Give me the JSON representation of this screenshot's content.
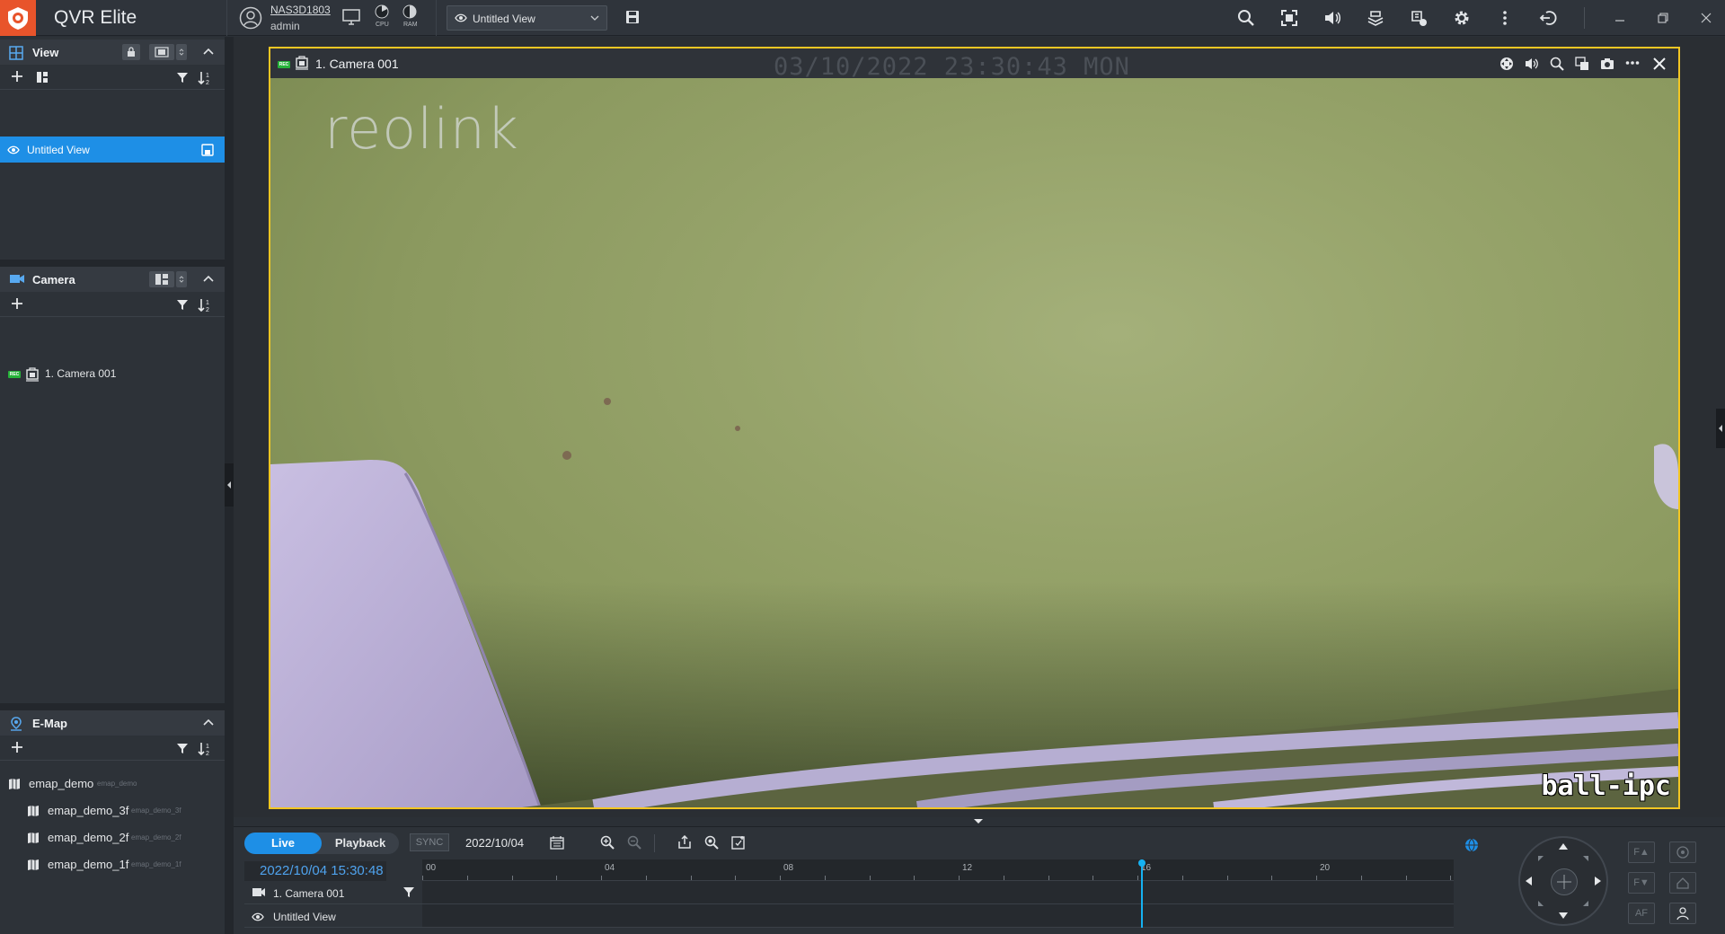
{
  "app": {
    "title": "QVR Elite"
  },
  "topbar": {
    "nas_name": "NAS3D1803",
    "user": "admin",
    "cpu_label": "CPU",
    "ram_label": "RAM",
    "view_select": "Untitled View",
    "icons": [
      "search-icon",
      "fullscreen-icon",
      "volume-icon",
      "layers-icon",
      "notification-icon",
      "settings-icon",
      "more-icon",
      "logout-icon",
      "minimize-icon",
      "restore-icon",
      "close-icon"
    ]
  },
  "sidebar": {
    "view": {
      "title": "View",
      "items": [
        {
          "label": "Untitled View"
        }
      ]
    },
    "camera": {
      "title": "Camera",
      "items": [
        {
          "label": "1. Camera 001",
          "rec": "REC"
        }
      ]
    },
    "emap": {
      "title": "E-Map",
      "items": [
        {
          "label": "emap_demo",
          "sub": "emap_demo"
        },
        {
          "label": "emap_demo_3f",
          "sub": "emap_demo_3f"
        },
        {
          "label": "emap_demo_2f",
          "sub": "emap_demo_2f"
        },
        {
          "label": "emap_demo_1f",
          "sub": "emap_demo_1f"
        }
      ]
    }
  },
  "video": {
    "title": "1. Camera 001",
    "rec": "REC",
    "osd_datetime": "03/10/2022 23:30:43 MON",
    "watermark": "reolink",
    "osd_name": "ball-ipc"
  },
  "bottom": {
    "live": "Live",
    "playback": "Playback",
    "sync": "SYNC",
    "date": "2022/10/04",
    "time_readout": "2022/10/04 15:30:48",
    "timeline_labels": [
      "00",
      "04",
      "08",
      "12",
      "16",
      "20"
    ],
    "tracks": [
      {
        "label": "1. Camera 001"
      },
      {
        "label": "Untitled View"
      }
    ],
    "ptz_buttons": [
      "F▲",
      "F▼",
      "AF"
    ]
  },
  "colors": {
    "accent": "#1e8fe6",
    "selection_border": "#f3c623",
    "rec": "#27b23a",
    "cursor": "#16b2f2",
    "brand": "#e8542b"
  }
}
